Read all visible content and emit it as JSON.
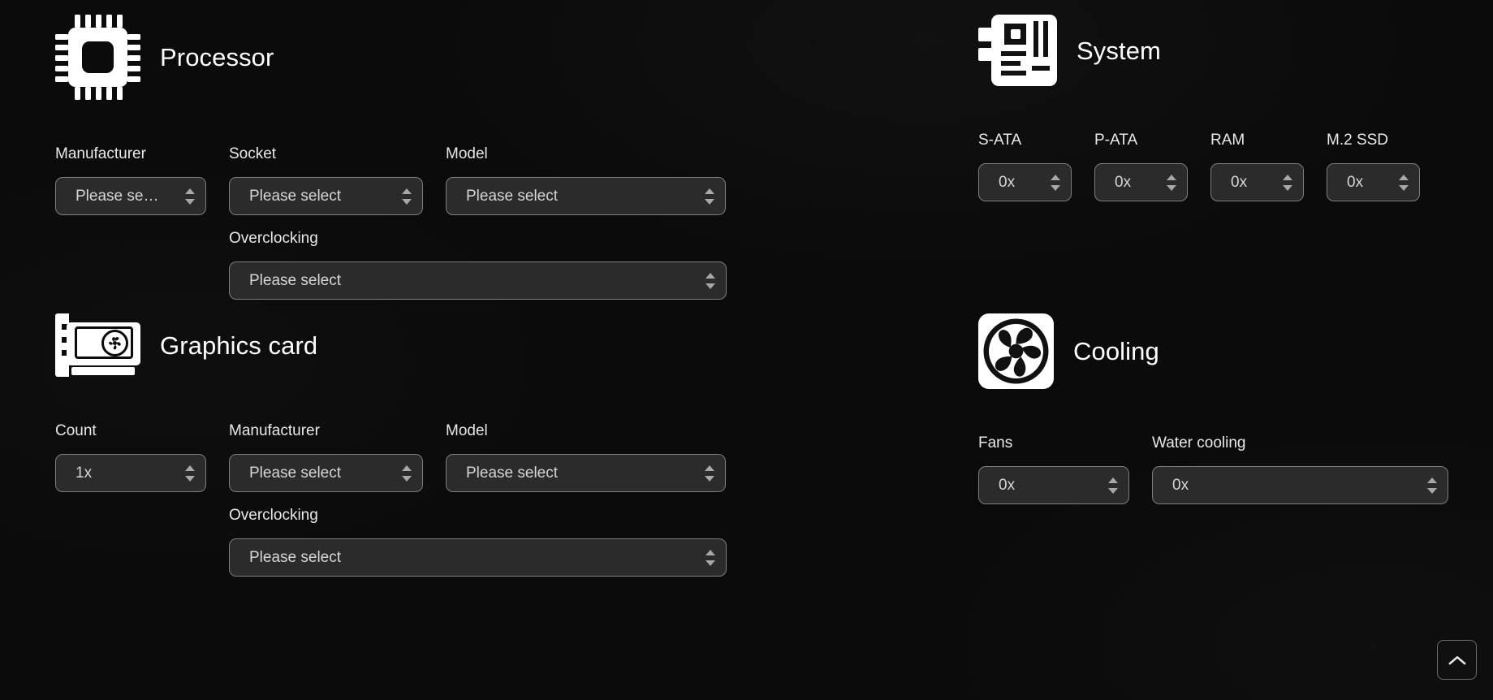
{
  "sections": {
    "processor": {
      "title": "Processor",
      "icon": "cpu-icon",
      "fields": [
        {
          "label": "Manufacturer",
          "value": "Please se…",
          "icon": "spinner-icon"
        },
        {
          "label": "Socket",
          "value": "Please select",
          "icon": "spinner-icon"
        },
        {
          "label": "Model",
          "value": "Please select",
          "icon": "spinner-icon"
        }
      ],
      "overclocking": {
        "label": "Overclocking",
        "value": "Please select"
      }
    },
    "system": {
      "title": "System",
      "icon": "motherboard-icon",
      "fields": [
        {
          "label": "S-ATA",
          "value": "0x"
        },
        {
          "label": "P-ATA",
          "value": "0x"
        },
        {
          "label": "RAM",
          "value": "0x"
        },
        {
          "label": "M.2 SSD",
          "value": "0x"
        }
      ]
    },
    "graphics": {
      "title": "Graphics card",
      "icon": "gpu-icon",
      "fields": [
        {
          "label": "Count",
          "value": "1x"
        },
        {
          "label": "Manufacturer",
          "value": "Please select"
        },
        {
          "label": "Model",
          "value": "Please select"
        }
      ],
      "overclocking": {
        "label": "Overclocking",
        "value": "Please select"
      }
    },
    "cooling": {
      "title": "Cooling",
      "icon": "fan-icon",
      "fields": [
        {
          "label": "Fans",
          "value": "0x"
        },
        {
          "label": "Water cooling",
          "value": "0x"
        }
      ]
    }
  },
  "scroll_top_button": {
    "icon": "chevron-up-icon",
    "label": ""
  },
  "colors": {
    "background": "#0b0b0b",
    "select_background": "#2b2b2b",
    "select_border": "#7e7e7e",
    "text": "#f2f2f2",
    "value_text": "#d6d6d6",
    "icon_fill": "#ffffff"
  }
}
